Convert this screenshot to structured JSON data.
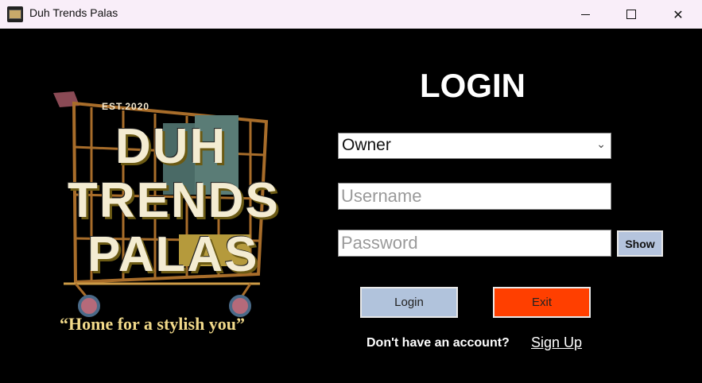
{
  "window": {
    "title": "Duh Trends Palas",
    "controls": {
      "minimize": "minimize-icon",
      "maximize": "maximize-icon",
      "close": "close-icon"
    }
  },
  "logo": {
    "est": "EST.2020",
    "brand_lines": [
      "DUH",
      "TRENDS",
      "PALAS"
    ],
    "tagline": "“Home for a stylish you”"
  },
  "form": {
    "title": "LOGIN",
    "role": {
      "selected": "Owner",
      "icon": "chevron-down-icon"
    },
    "username": {
      "placeholder": "Username",
      "value": ""
    },
    "password": {
      "placeholder": "Password",
      "value": ""
    },
    "show_label": "Show",
    "login_label": "Login",
    "exit_label": "Exit",
    "no_account_text": "Don't have an account?",
    "signup_label": "Sign Up"
  },
  "colors": {
    "background": "#000000",
    "titlebar": "#f9eef9",
    "login_button": "#b1c3dc",
    "exit_button": "#ff3f00",
    "show_button": "#b5c4dd",
    "brand_text": "#f4ecd2",
    "tagline": "#f1d98a"
  }
}
